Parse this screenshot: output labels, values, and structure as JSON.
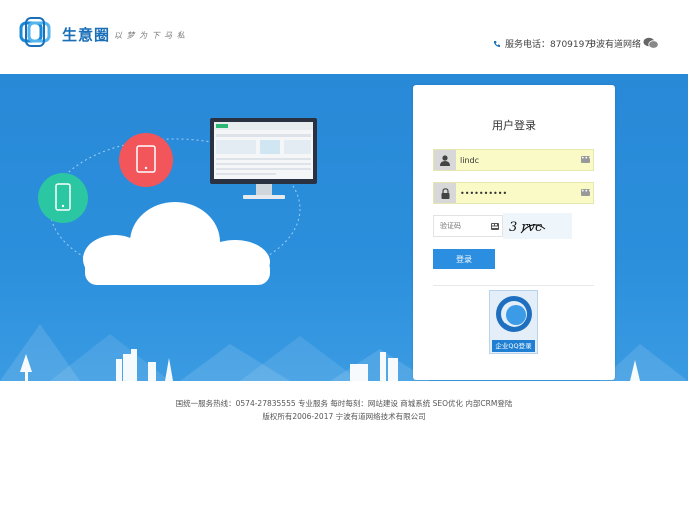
{
  "header": {
    "brand": "生意圈",
    "slogan": "以 梦 为 下 马 私",
    "hotline_label": "服务电话：87091970",
    "company": "宁波有道网络",
    "wechat_icon": "wechat-icon",
    "phone_icon": "phone-icon"
  },
  "login": {
    "title": "用户登录",
    "username_value": "lindc",
    "password_value": "••••••••••",
    "captcha_placeholder": "验证码",
    "captcha_text": "3 rvc",
    "submit_label": "登录",
    "qq_label": "企业QQ登录"
  },
  "footer": {
    "line1": "国统一服务热线：0574-27835555 专业服务 每时每刻：网站建设 商城系统 SEO优化 内部CRM登陆",
    "line2": "版权所有2006-2017 宁波有道网络技术有限公司"
  },
  "colors": {
    "brand_blue": "#1a6fb8",
    "banner_blue": "#2b8fdc",
    "input_yellow": "#fafac6",
    "button_blue": "#2c8ee0"
  }
}
